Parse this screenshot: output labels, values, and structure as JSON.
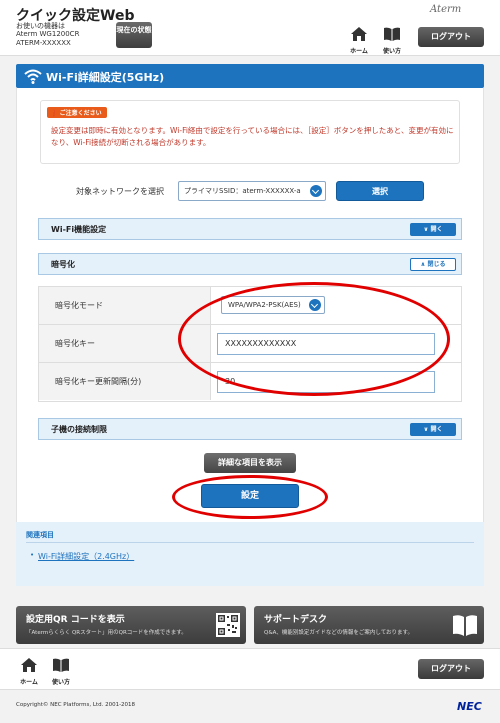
{
  "header": {
    "app_title": "クイック設定Web",
    "device_label": "お使いの機器は",
    "device_model": "Aterm WG1200CR",
    "device_id": "ATERM-XXXXXX",
    "status_button": "現在の状態",
    "logo": "Aterm",
    "home_label": "ホーム",
    "help_label": "使い方",
    "logout_label": "ログアウト"
  },
  "page": {
    "title": "Wi-Fi詳細設定(5GHz)"
  },
  "notice": {
    "badge": "ご注意ください",
    "text": "設定変更は即時に有効となります。Wi-Fi経由で設定を行っている場合には、［設定］ボタンを押したあと、変更が有効になり、Wi-Fi接続が切断される場合があります。"
  },
  "network_select": {
    "label": "対象ネットワークを選択",
    "value": "プライマリSSID：aterm-XXXXXX-a",
    "button": "選択"
  },
  "sections": {
    "wifi_function": {
      "title": "Wi-Fi機能設定",
      "toggle": "開く"
    },
    "encryption": {
      "title": "暗号化",
      "toggle": "閉じる"
    },
    "client_limit": {
      "title": "子機の接続制限",
      "toggle": "開く"
    }
  },
  "encryption": {
    "mode_label": "暗号化モード",
    "mode_value": "WPA/WPA2-PSK(AES)",
    "key_label": "暗号化キー",
    "key_value": "XXXXXXXXXXXXX",
    "interval_label": "暗号化キー更新間隔(分)",
    "interval_value": "30"
  },
  "buttons": {
    "show_details": "詳細な項目を表示",
    "apply": "設定"
  },
  "related": {
    "title": "関連項目",
    "link": "Wi-Fi詳細設定（2.4GHz）"
  },
  "promo": {
    "qr_title": "設定用QR コードを表示",
    "qr_sub": "「Atermらくらく QRスタート」用のQRコードを作成できます。",
    "support_title": "サポートデスク",
    "support_sub": "Q&A、機能別設定ガイドなどの情報をご案内しております。"
  },
  "footer": {
    "home_label": "ホーム",
    "help_label": "使い方",
    "logout_label": "ログアウト",
    "copyright": "Copyright© NEC Platforms, Ltd. 2001-2018",
    "nec_logo": "NEC"
  },
  "colors": {
    "accent": "#1e73be",
    "notice_text": "#c0392b",
    "annotation": "#e00000"
  }
}
